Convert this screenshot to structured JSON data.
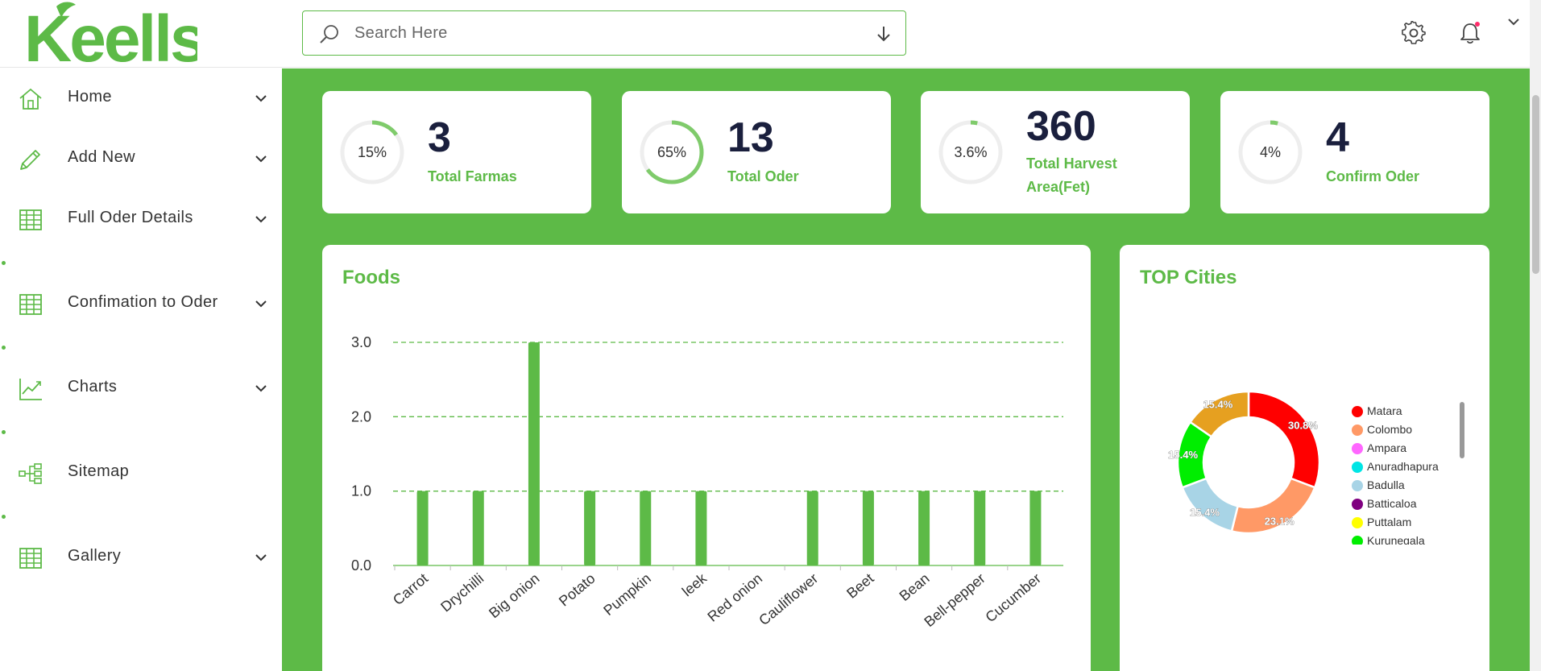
{
  "brand": {
    "logo_text": "Keells",
    "accent": "#5dba47",
    "dark": "#1a1f3d"
  },
  "search": {
    "placeholder": "Search Here"
  },
  "topbar": {
    "icons": [
      "search-icon",
      "download-arrow-icon",
      "gear-icon",
      "bell-icon",
      "chevron-down-icon"
    ]
  },
  "sidebar": {
    "items": [
      {
        "label": "Home",
        "icon": "home-icon"
      },
      {
        "label": "Add New",
        "icon": "pencil-icon"
      },
      {
        "label": "Full Oder Details",
        "icon": "table-icon"
      },
      {
        "label": "Confimation to Oder",
        "icon": "table-icon"
      },
      {
        "label": "Charts",
        "icon": "chart-line-icon"
      },
      {
        "label": "Sitemap",
        "icon": "sitemap-icon"
      },
      {
        "label": "Gallery",
        "icon": "table-icon"
      }
    ]
  },
  "stats": [
    {
      "percent": "15%",
      "value": "3",
      "label": "Total Farmas",
      "fraction": 0.15
    },
    {
      "percent": "65%",
      "value": "13",
      "label": "Total Oder",
      "fraction": 0.65
    },
    {
      "percent": "3.6%",
      "value": "360",
      "label": "Total Harvest Area(Fet)",
      "fraction": 0.036
    },
    {
      "percent": "4%",
      "value": "4",
      "label": "Confirm Oder",
      "fraction": 0.04
    }
  ],
  "foods_card": {
    "title": "Foods"
  },
  "cities_card": {
    "title": "TOP Cities"
  },
  "chart_data": [
    {
      "type": "bar",
      "title": "Foods",
      "categories": [
        "Carrot",
        "Drychilli",
        "Big onion",
        "Potato",
        "Pumpkin",
        "leek",
        "Red onion",
        "Cauliflower",
        "Beet",
        "Bean",
        "Bell-pepper",
        "Cucumber"
      ],
      "values": [
        1,
        1,
        3,
        1,
        1,
        1,
        0,
        1,
        1,
        1,
        1,
        1
      ],
      "yticks": [
        "0.0",
        "1.0",
        "2.0",
        "3.0"
      ],
      "ylim": [
        0,
        3
      ],
      "grid": true,
      "color": "#5dba47"
    },
    {
      "type": "pie",
      "title": "TOP Cities",
      "slices": [
        {
          "label": "Matara",
          "value": 30.8,
          "color": "#ff0000",
          "shown": "30.8%"
        },
        {
          "label": "Colombo",
          "value": 23.1,
          "color": "#ff9966",
          "shown": "23.1%"
        },
        {
          "label": "Ampara",
          "value": 0,
          "color": "#ff66ff",
          "shown": ""
        },
        {
          "label": "Anuradhapura",
          "value": 0,
          "color": "#00e5e5",
          "shown": ""
        },
        {
          "label": "Badulla",
          "value": 15.4,
          "color": "#a8d4e6",
          "shown": "15.4%"
        },
        {
          "label": "Batticaloa",
          "value": 0,
          "color": "#800080",
          "shown": ""
        },
        {
          "label": "Puttalam",
          "value": 0,
          "color": "#ffff00",
          "shown": ""
        },
        {
          "label": "Kurunegala",
          "value": 15.4,
          "color": "#00ee00",
          "shown": "15.4%"
        },
        {
          "label": "",
          "value": 15.4,
          "color": "#e6a020",
          "shown": "15.4%"
        }
      ],
      "legend_position": "right"
    }
  ]
}
